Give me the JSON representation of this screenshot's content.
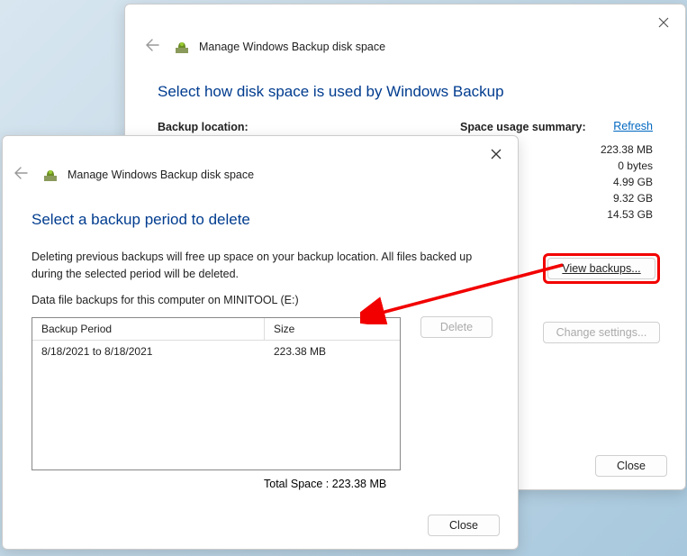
{
  "back_window": {
    "title": "Manage Windows Backup disk space",
    "heading": "Select how disk space is used by Windows Backup",
    "backup_location_label": "Backup location:",
    "space_summary_label": "Space usage summary:",
    "refresh_label": "Refresh",
    "summary_values": [
      "223.38 MB",
      "0 bytes",
      "4.99 GB",
      "9.32 GB",
      "14.53 GB"
    ],
    "view_backups_label": "View backups...",
    "change_settings_label": "Change settings...",
    "close_label": "Close"
  },
  "front_window": {
    "title": "Manage Windows Backup disk space",
    "heading": "Select a backup period to delete",
    "desc1": "Deleting previous backups will free up space on your backup location. All files backed up during the selected period will be deleted.",
    "desc2": "Data file backups for this computer on MINITOOL (E:)",
    "columns": {
      "period": "Backup Period",
      "size": "Size"
    },
    "rows": [
      {
        "period": "8/18/2021 to 8/18/2021",
        "size": "223.38 MB"
      }
    ],
    "delete_label": "Delete",
    "total_space_label": "Total Space : 223.38 MB",
    "close_label": "Close"
  }
}
